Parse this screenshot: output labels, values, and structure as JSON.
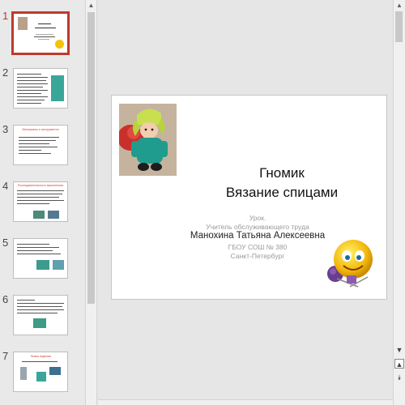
{
  "thumbnails": {
    "numbers": [
      "1",
      "2",
      "3",
      "4",
      "5",
      "6",
      "7"
    ],
    "slide3_title": "Материалы и инструменты",
    "slide4_title": "Последовательность выполнения",
    "slide7_title": "Этапы изделия"
  },
  "slide": {
    "title_line1": "Гномик",
    "title_line2": "Вязание спицами",
    "lesson": "Урок.",
    "role": "Учитель обслуживающего труда",
    "author": "Манохина Татьяна Алексеевна",
    "school": "ГБОУ СОШ № 380",
    "city": "Санкт-Петербург"
  },
  "colors": {
    "accent": "#c0392b",
    "title": "#111111",
    "subtitle": "#9a9a9a"
  },
  "icons": [
    "scroll-up-icon",
    "scroll-down-icon",
    "prev-slide-icon",
    "next-slide-icon"
  ]
}
